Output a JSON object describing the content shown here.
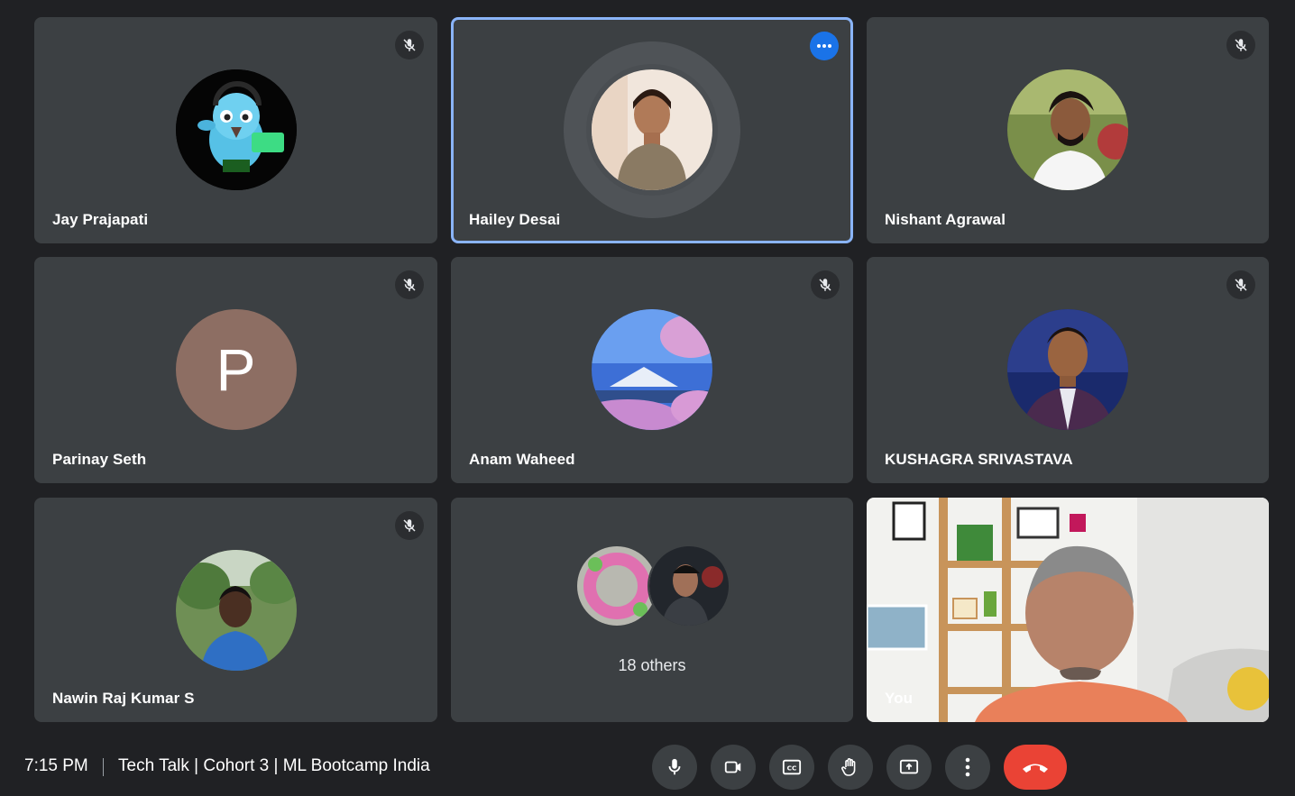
{
  "participants": [
    {
      "name": "Jay Prajapati",
      "muted": true,
      "avatar_icon": "bird-cartoon-avatar"
    },
    {
      "name": "Hailey Desai",
      "muted": false,
      "speaking": true,
      "avatar_icon": "profile-photo"
    },
    {
      "name": "Nishant Agrawal",
      "muted": true,
      "avatar_icon": "profile-photo"
    },
    {
      "name": "Parinay Seth",
      "muted": true,
      "initial": "P",
      "avatar_color": "#8d6e63"
    },
    {
      "name": "Anam Waheed",
      "muted": true,
      "avatar_icon": "mountain-blossom-photo"
    },
    {
      "name": "KUSHAGRA SRIVASTAVA",
      "muted": true,
      "avatar_icon": "profile-photo"
    },
    {
      "name": "Nawin Raj Kumar S",
      "muted": true,
      "avatar_icon": "profile-photo"
    }
  ],
  "others": {
    "label": "18 others"
  },
  "self": {
    "label": "You"
  },
  "footer": {
    "time": "7:15 PM",
    "meeting_title": "Tech Talk | Cohort 3 | ML Bootcamp India"
  },
  "controls": [
    "microphone-icon",
    "camera-icon",
    "captions-icon",
    "raise-hand-icon",
    "present-screen-icon",
    "more-options-icon",
    "end-call-icon"
  ],
  "colors": {
    "background": "#202124",
    "tile": "#3c4043",
    "active_border": "#8ab4f8",
    "end_call": "#ea4335",
    "accent": "#1a73e8"
  }
}
